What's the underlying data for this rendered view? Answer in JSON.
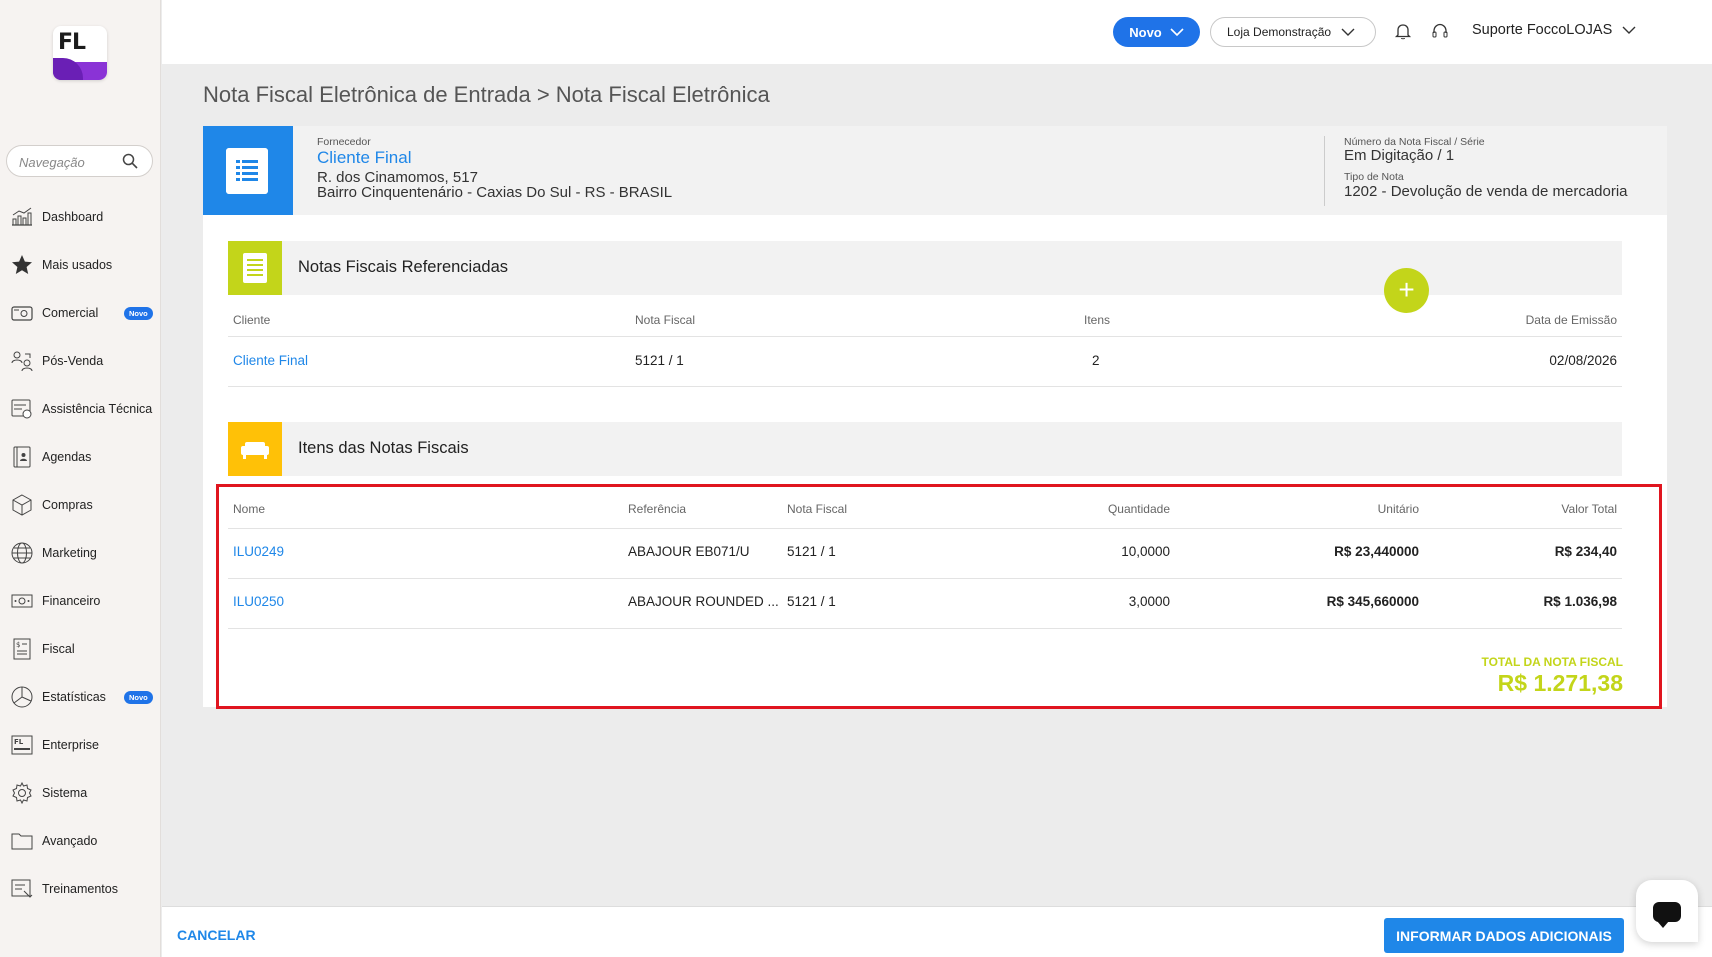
{
  "sidebar": {
    "logo": "FL",
    "search_placeholder": "Navegação",
    "items": [
      {
        "label": "Dashboard",
        "icon": "dashboard-icon"
      },
      {
        "label": "Mais usados",
        "icon": "star-icon"
      },
      {
        "label": "Comercial",
        "icon": "register-icon",
        "badge": "Novo"
      },
      {
        "label": "Pós-Venda",
        "icon": "people-icon"
      },
      {
        "label": "Assistência Técnica",
        "icon": "tools-icon"
      },
      {
        "label": "Agendas",
        "icon": "agenda-icon"
      },
      {
        "label": "Compras",
        "icon": "box-icon"
      },
      {
        "label": "Marketing",
        "icon": "globe-icon"
      },
      {
        "label": "Financeiro",
        "icon": "money-icon"
      },
      {
        "label": "Fiscal",
        "icon": "fiscal-doc-icon"
      },
      {
        "label": "Estatísticas",
        "icon": "pie-chart-icon",
        "badge": "Novo"
      },
      {
        "label": "Enterprise",
        "icon": "enterprise-icon"
      },
      {
        "label": "Sistema",
        "icon": "gear-icon"
      },
      {
        "label": "Avançado",
        "icon": "folder-icon"
      },
      {
        "label": "Treinamentos",
        "icon": "training-icon"
      }
    ]
  },
  "header": {
    "novo_label": "Novo",
    "store_label": "Loja Demonstração",
    "user_label": "Suporte FoccoLOJAS"
  },
  "page": {
    "title": "Nota Fiscal Eletrônica de Entrada > Nota Fiscal Eletrônica"
  },
  "doc": {
    "fornecedor_label": "Fornecedor",
    "fornecedor_name": "Cliente Final",
    "address_line1": "R. dos Cinamomos, 517",
    "address_line2": "Bairro Cinquentenário - Caxias Do Sul - RS - BRASIL",
    "nf_label": "Número da Nota Fiscal / Série",
    "nf_value": "Em Digitação / 1",
    "tipo_label": "Tipo de Nota",
    "tipo_value": "1202 - Devolução de venda de mercadoria"
  },
  "referenced": {
    "title": "Notas Fiscais Referenciadas",
    "add_label": "+",
    "headers": {
      "cliente": "Cliente",
      "nota": "Nota Fiscal",
      "itens": "Itens",
      "data": "Data de Emissão"
    },
    "rows": [
      {
        "cliente": "Cliente Final",
        "nota": "5121 / 1",
        "itens": "2",
        "data": "02/08/2026"
      }
    ]
  },
  "items": {
    "title": "Itens das Notas Fiscais",
    "headers": {
      "nome": "Nome",
      "referencia": "Referência",
      "nota": "Nota Fiscal",
      "quantidade": "Quantidade",
      "unitario": "Unitário",
      "total": "Valor Total"
    },
    "rows": [
      {
        "nome": "ILU0249",
        "referencia": "ABAJOUR EB071/U",
        "nota": "5121 / 1",
        "quantidade": "10,0000",
        "unitario": "R$ 23,440000",
        "total": "R$ 234,40"
      },
      {
        "nome": "ILU0250",
        "referencia": "ABAJOUR ROUNDED ...",
        "nota": "5121 / 1",
        "quantidade": "3,0000",
        "unitario": "R$ 345,660000",
        "total": "R$ 1.036,98"
      }
    ],
    "total_label": "TOTAL DA NOTA FISCAL",
    "total_value": "R$ 1.271,38"
  },
  "footer": {
    "cancel_label": "CANCELAR",
    "info_label": "INFORMAR DADOS ADICIONAIS"
  },
  "colors": {
    "primary": "#1f87e8",
    "accent_green": "#c3d51a",
    "accent_yellow": "#ffc107",
    "highlight_red": "#e0151f"
  }
}
